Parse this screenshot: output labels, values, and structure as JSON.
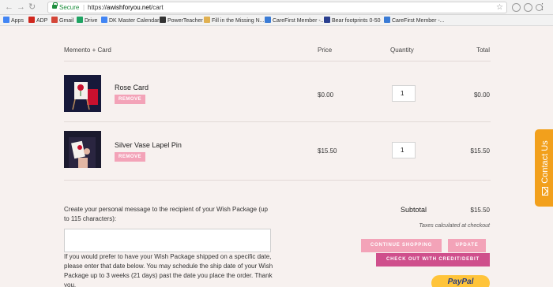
{
  "browser": {
    "secure_label": "Secure",
    "url_scheme": "https://",
    "url_host": "awishforyou.net",
    "url_path": "/cart"
  },
  "bookmarks": [
    {
      "label": "Apps",
      "icon": "apps-grid-icon",
      "color": "#4285f4"
    },
    {
      "label": "ADP",
      "icon": "adp-icon",
      "color": "#d0271d"
    },
    {
      "label": "Gmail",
      "icon": "gmail-icon",
      "color": "#d44638"
    },
    {
      "label": "Drive",
      "icon": "drive-icon",
      "color": "#1fa463"
    },
    {
      "label": "DK Master Calendar",
      "icon": "calendar-icon",
      "color": "#4285f4"
    },
    {
      "label": "PowerTeacher",
      "icon": "powerteacher-icon",
      "color": "#333333"
    },
    {
      "label": "Fill in the Missing N...",
      "icon": "bookmark-icon",
      "color": "#e0b050"
    },
    {
      "label": "CareFirst Member -...",
      "icon": "carefirst-icon",
      "color": "#3a7bd5"
    },
    {
      "label": "Bear footprints 0-50",
      "icon": "sb-icon",
      "color": "#2a3f8f"
    },
    {
      "label": "CareFirst Member -...",
      "icon": "carefirst-icon",
      "color": "#3a7bd5"
    }
  ],
  "table": {
    "headers": {
      "product": "Memento + Card",
      "price": "Price",
      "quantity": "Quantity",
      "total": "Total"
    },
    "rows": [
      {
        "name": "Rose Card",
        "remove_label": "REMOVE",
        "price": "$0.00",
        "quantity": "1",
        "total": "$0.00"
      },
      {
        "name": "Silver Vase Lapel Pin",
        "remove_label": "REMOVE",
        "price": "$15.50",
        "quantity": "1",
        "total": "$15.50"
      }
    ]
  },
  "message": {
    "prompt": "Create your personal message to the recipient of your Wish Package (up to 115 characters):",
    "value": "",
    "ship_note": "If you would prefer to have your Wish Package shipped on a specific date, please enter that date below. You may schedule the ship date of your Wish Package up to 3 weeks (21 days) past the date you place the order. Thank you."
  },
  "summary": {
    "subtotal_label": "Subtotal",
    "subtotal_value": "$15.50",
    "taxes_note": "Taxes calculated at checkout",
    "continue_label": "CONTINUE SHOPPING",
    "update_label": "UPDATE",
    "checkout_label": "CHECK OUT WITH CREDIT/DEBIT",
    "paypal_label": "PayPal"
  },
  "contact_tab": {
    "label": "Contact Us"
  },
  "colors": {
    "accent_pink": "#f3a3b8",
    "accent_magenta": "#cf4f8c",
    "contact_orange": "#f2a01c",
    "paypal_yellow": "#ffc43a",
    "page_bg": "#f7f1ef"
  }
}
